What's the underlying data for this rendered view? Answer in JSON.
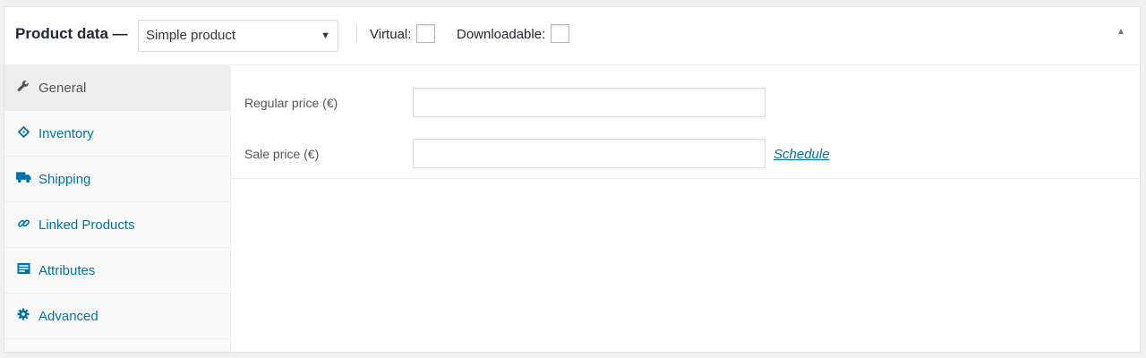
{
  "header": {
    "title": "Product data —",
    "product_type": {
      "selected": "Simple product"
    },
    "virtual_label": "Virtual:",
    "downloadable_label": "Downloadable:",
    "virtual_checked": false,
    "downloadable_checked": false
  },
  "tabs": [
    {
      "label": "General",
      "icon": "wrench-icon",
      "active": true
    },
    {
      "label": "Inventory",
      "icon": "tag-icon",
      "active": false
    },
    {
      "label": "Shipping",
      "icon": "truck-icon",
      "active": false
    },
    {
      "label": "Linked Products",
      "icon": "link-icon",
      "active": false
    },
    {
      "label": "Attributes",
      "icon": "list-icon",
      "active": false
    },
    {
      "label": "Advanced",
      "icon": "gear-icon",
      "active": false
    }
  ],
  "general": {
    "regular_price_label": "Regular price (€)",
    "regular_price_value": "",
    "sale_price_label": "Sale price (€)",
    "sale_price_value": "",
    "schedule_link": "Schedule"
  },
  "colors": {
    "link": "#0073aa",
    "active_tab_text": "#555555",
    "active_tab_bg": "#eeeeee",
    "sidebar_bg": "#fafafa"
  }
}
